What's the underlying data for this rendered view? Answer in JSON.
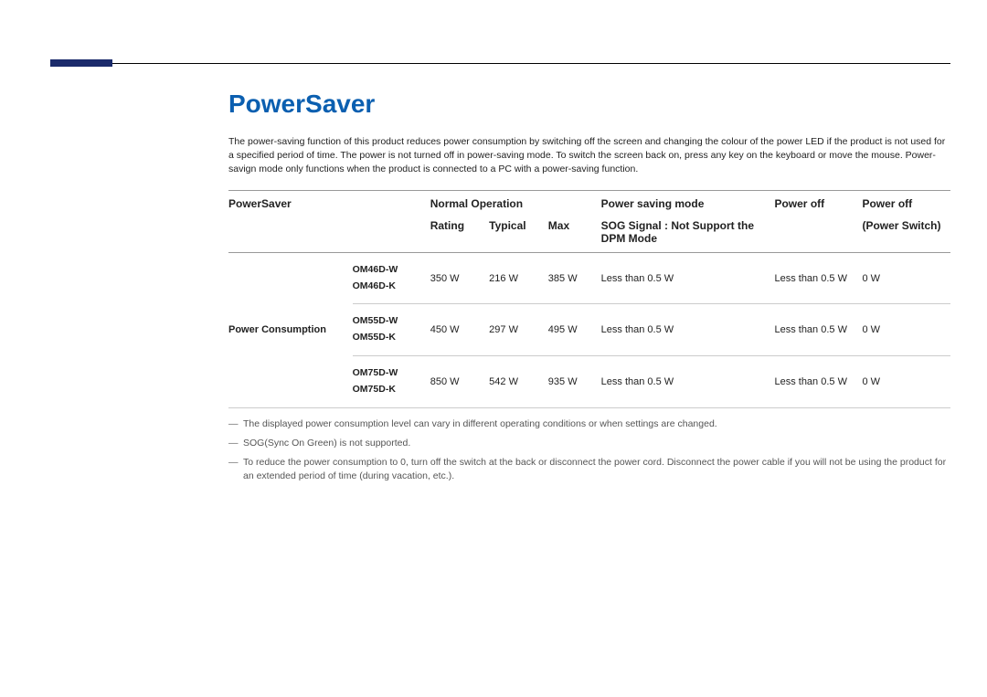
{
  "title": "PowerSaver",
  "intro": "The power-saving function of this product reduces power consumption by switching off the screen and changing the colour of the power LED if the product is not used for a specified period of time. The power is not turned off in power-saving mode. To switch the screen back on, press any key on the keyboard or move the mouse. Power-savign mode only functions when the product is connected to a PC with a power-saving function.",
  "headers": {
    "powersaver": "PowerSaver",
    "normal_op": "Normal Operation",
    "psm": "Power saving mode",
    "poff": "Power off",
    "poff2": "Power off",
    "rating": "Rating",
    "typical": "Typical",
    "max": "Max",
    "sog": "SOG Signal : Not Support the DPM Mode",
    "pswitch": "(Power Switch)"
  },
  "row_label": "Power Consumption",
  "rows": [
    {
      "model_a": "OM46D-W",
      "model_b": "OM46D-K",
      "rating": "350 W",
      "typical": "216 W",
      "max": "385 W",
      "psm": "Less than 0.5 W",
      "poff": "Less than 0.5 W",
      "poff2": "0 W"
    },
    {
      "model_a": "OM55D-W",
      "model_b": "OM55D-K",
      "rating": "450 W",
      "typical": "297 W",
      "max": "495 W",
      "psm": "Less than 0.5 W",
      "poff": "Less than 0.5 W",
      "poff2": "0 W"
    },
    {
      "model_a": "OM75D-W",
      "model_b": "OM75D-K",
      "rating": "850 W",
      "typical": "542 W",
      "max": "935 W",
      "psm": "Less than 0.5 W",
      "poff": "Less than 0.5 W",
      "poff2": "0 W"
    }
  ],
  "notes": {
    "n1": "The displayed power consumption level can vary in different operating conditions or when settings are changed.",
    "n2": "SOG(Sync On Green) is not supported.",
    "n3": "To reduce the power consumption to 0, turn off the switch at the back or disconnect the power cord. Disconnect the power cable if you will not be using the product for an extended period of time (during vacation, etc.)."
  }
}
